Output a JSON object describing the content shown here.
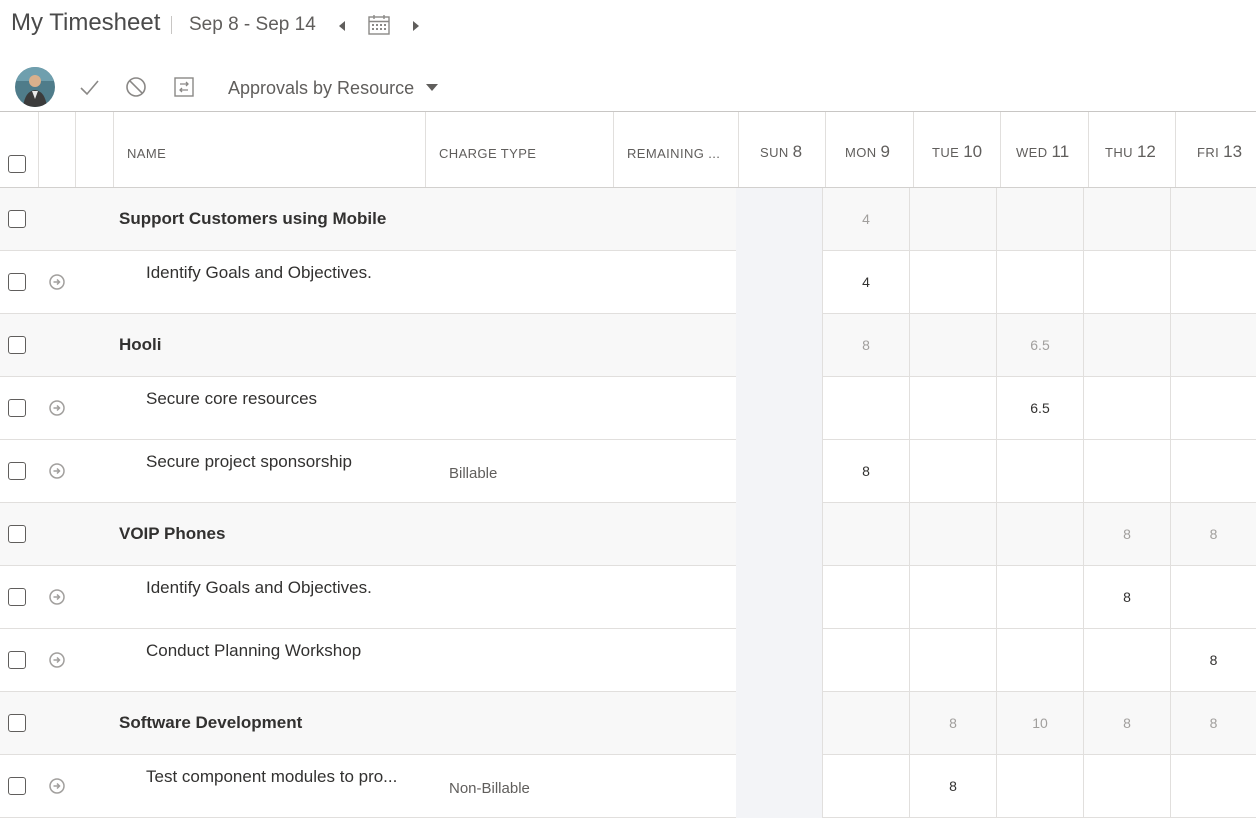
{
  "header": {
    "title": "My Timesheet",
    "date_range": "Sep 8 - Sep 14"
  },
  "toolbar": {
    "approvals_label": "Approvals by Resource"
  },
  "columns": {
    "name": "NAME",
    "charge_type": "CHARGE TYPE",
    "remaining": "REMAINING ...",
    "days": [
      {
        "dow": "SUN",
        "num": "8"
      },
      {
        "dow": "MON",
        "num": "9"
      },
      {
        "dow": "TUE",
        "num": "10"
      },
      {
        "dow": "WED",
        "num": "11"
      },
      {
        "dow": "THU",
        "num": "12"
      },
      {
        "dow": "FRI",
        "num": "13"
      }
    ]
  },
  "rows": [
    {
      "type": "group",
      "name": "Support Customers using Mobile",
      "charge": "",
      "hours": [
        "",
        "4",
        "",
        "",
        "",
        ""
      ]
    },
    {
      "type": "task",
      "name": "Identify Goals and Objectives.",
      "charge": "",
      "hours": [
        "",
        "4",
        "",
        "",
        "",
        ""
      ]
    },
    {
      "type": "group",
      "name": "Hooli",
      "charge": "",
      "hours": [
        "",
        "8",
        "",
        "6.5",
        "",
        ""
      ]
    },
    {
      "type": "task",
      "name": "Secure core resources",
      "charge": "",
      "hours": [
        "",
        "",
        "",
        "6.5",
        "",
        ""
      ]
    },
    {
      "type": "task",
      "name": "Secure project sponsorship",
      "charge": "Billable",
      "hours": [
        "",
        "8",
        "",
        "",
        "",
        ""
      ]
    },
    {
      "type": "group",
      "name": "VOIP Phones",
      "charge": "",
      "hours": [
        "",
        "",
        "",
        "",
        "8",
        "8"
      ]
    },
    {
      "type": "task",
      "name": "Identify Goals and Objectives.",
      "charge": "",
      "hours": [
        "",
        "",
        "",
        "",
        "8",
        ""
      ]
    },
    {
      "type": "task",
      "name": " Conduct Planning Workshop",
      "charge": "",
      "hours": [
        "",
        "",
        "",
        "",
        "",
        "8"
      ]
    },
    {
      "type": "group",
      "name": "Software Development",
      "charge": "",
      "hours": [
        "",
        "",
        "8",
        "10",
        "8",
        "8"
      ]
    },
    {
      "type": "task",
      "name": "Test component modules to pro...",
      "charge": "Non-Billable",
      "hours": [
        "",
        "",
        "8",
        "",
        "",
        ""
      ]
    }
  ]
}
